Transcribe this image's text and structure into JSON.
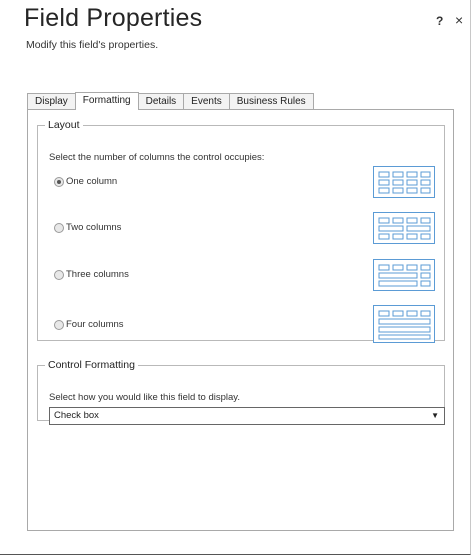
{
  "header": {
    "title": "Field Properties",
    "subtitle": "Modify this field's properties.",
    "help": "?",
    "close": "×"
  },
  "tabs": [
    {
      "label": "Display",
      "active": false
    },
    {
      "label": "Formatting",
      "active": true
    },
    {
      "label": "Details",
      "active": false
    },
    {
      "label": "Events",
      "active": false
    },
    {
      "label": "Business Rules",
      "active": false
    }
  ],
  "layout": {
    "legend": "Layout",
    "instruction": "Select the number of columns the control occupies:",
    "options": [
      {
        "label": "One column",
        "selected": true
      },
      {
        "label": "Two columns",
        "selected": false
      },
      {
        "label": "Three columns",
        "selected": false
      },
      {
        "label": "Four columns",
        "selected": false
      }
    ]
  },
  "control_formatting": {
    "legend": "Control Formatting",
    "instruction": "Select how you would like this field to display.",
    "selected_value": "Check box",
    "arrow": "▼"
  },
  "colors": {
    "preview_border": "#5b9bd5"
  }
}
